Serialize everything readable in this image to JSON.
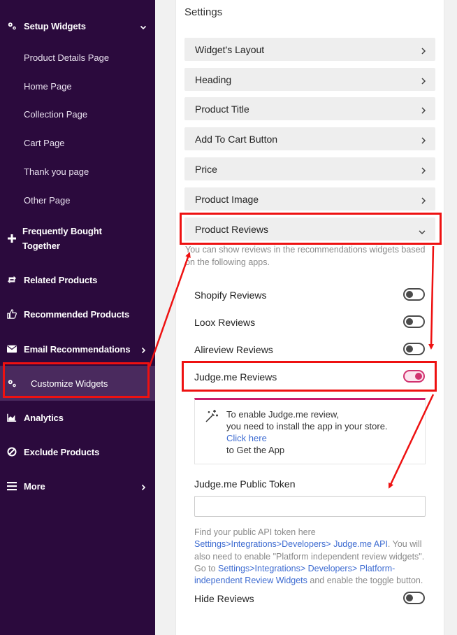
{
  "sidebar": {
    "setup": "Setup Widgets",
    "sub_items": [
      "Product Details Page",
      "Home Page",
      "Collection Page",
      "Cart Page",
      "Thank you page",
      "Other Page"
    ],
    "fbt_line1": "Frequently Bought",
    "fbt_line2": "Together",
    "related": "Related Products",
    "recommended": "Recommended Products",
    "email": "Email Recommendations",
    "customize": "Customize Widgets",
    "analytics": "Analytics",
    "exclude": "Exclude Products",
    "more": "More"
  },
  "settings": {
    "title": "Settings",
    "sections": [
      "Widget's Layout",
      "Heading",
      "Product Title",
      "Add To Cart Button",
      "Price",
      "Product Image"
    ],
    "reviews_section": "Product Reviews",
    "reviews_desc": "You can show reviews in the recommendations widgets based on the following apps.",
    "toggles": [
      {
        "label": "Shopify Reviews",
        "on": false
      },
      {
        "label": "Loox Reviews",
        "on": false
      },
      {
        "label": "Alireview Reviews",
        "on": false
      },
      {
        "label": "Judge.me Reviews",
        "on": true
      }
    ],
    "info": {
      "line1": "To enable Judge.me review,",
      "line2": "you need to install the app in your store.",
      "link": "Click here",
      "line3": "to Get the App"
    },
    "token_label": "Judge.me Public Token",
    "token_value": "",
    "help": {
      "t1": "Find your public API token here",
      "l1": "Settings>Integrations>Developers> Judge.me API",
      "t2": ". You will also need to enable \"Platform independent review widgets\". Go to ",
      "l2": "Settings>Integrations> Developers> Platform-independent Review Widgets",
      "t3": " and enable the toggle button."
    },
    "hide_reviews": {
      "label": "Hide Reviews",
      "on": false
    }
  },
  "colors": {
    "sidebar_bg": "#2b0a3d",
    "accent": "#d1326f",
    "annotation": "#ee1111",
    "link": "#3d6bd1"
  }
}
